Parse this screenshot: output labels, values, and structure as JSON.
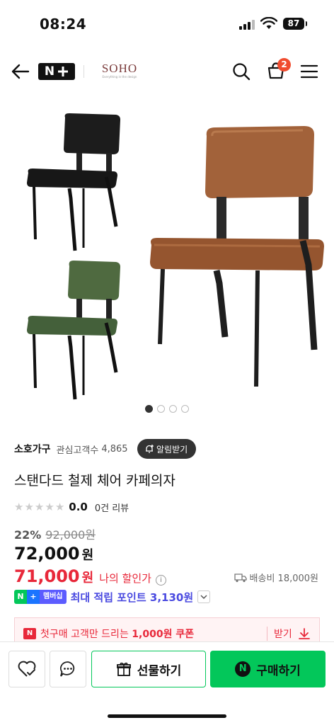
{
  "status": {
    "time": "08:24",
    "battery": "87"
  },
  "header": {
    "logo_text": "N",
    "brand_name": "SOHO",
    "brand_tagline": "Everything in the design",
    "cart_count": "2"
  },
  "gallery": {
    "image_count": 4,
    "active_index": 0
  },
  "seller": {
    "name": "소호가구",
    "fav_label": "관심고객수",
    "fav_count": "4,865",
    "alert_label": "알림받기"
  },
  "product": {
    "title": "스탠다드 철제 체어 카페의자",
    "rating": "0.0",
    "review_count": "0건 리뷰",
    "stars": 5
  },
  "price": {
    "discount_rate": "22%",
    "original": "92,000원",
    "sale": "72,000",
    "sale_unit": "원",
    "my_price": "71,000",
    "my_unit": "원",
    "my_label": "나의 할인가",
    "shipping": "배송비 18,000원"
  },
  "points": {
    "member_label": "멤버십",
    "text": "최대 적립 포인트 3,130원"
  },
  "coupon": {
    "text_prefix": "첫구매 고객만 드리는 ",
    "text_bold": "1,000원 쿠폰",
    "get_label": "받기"
  },
  "bottom": {
    "gift_label": "선물하기",
    "buy_label": "구매하기"
  },
  "colors": {
    "naver_green": "#03c75a",
    "price_red": "#e8283a",
    "points_blue": "#4a4ae0",
    "cart_badge": "#f04c2f"
  }
}
